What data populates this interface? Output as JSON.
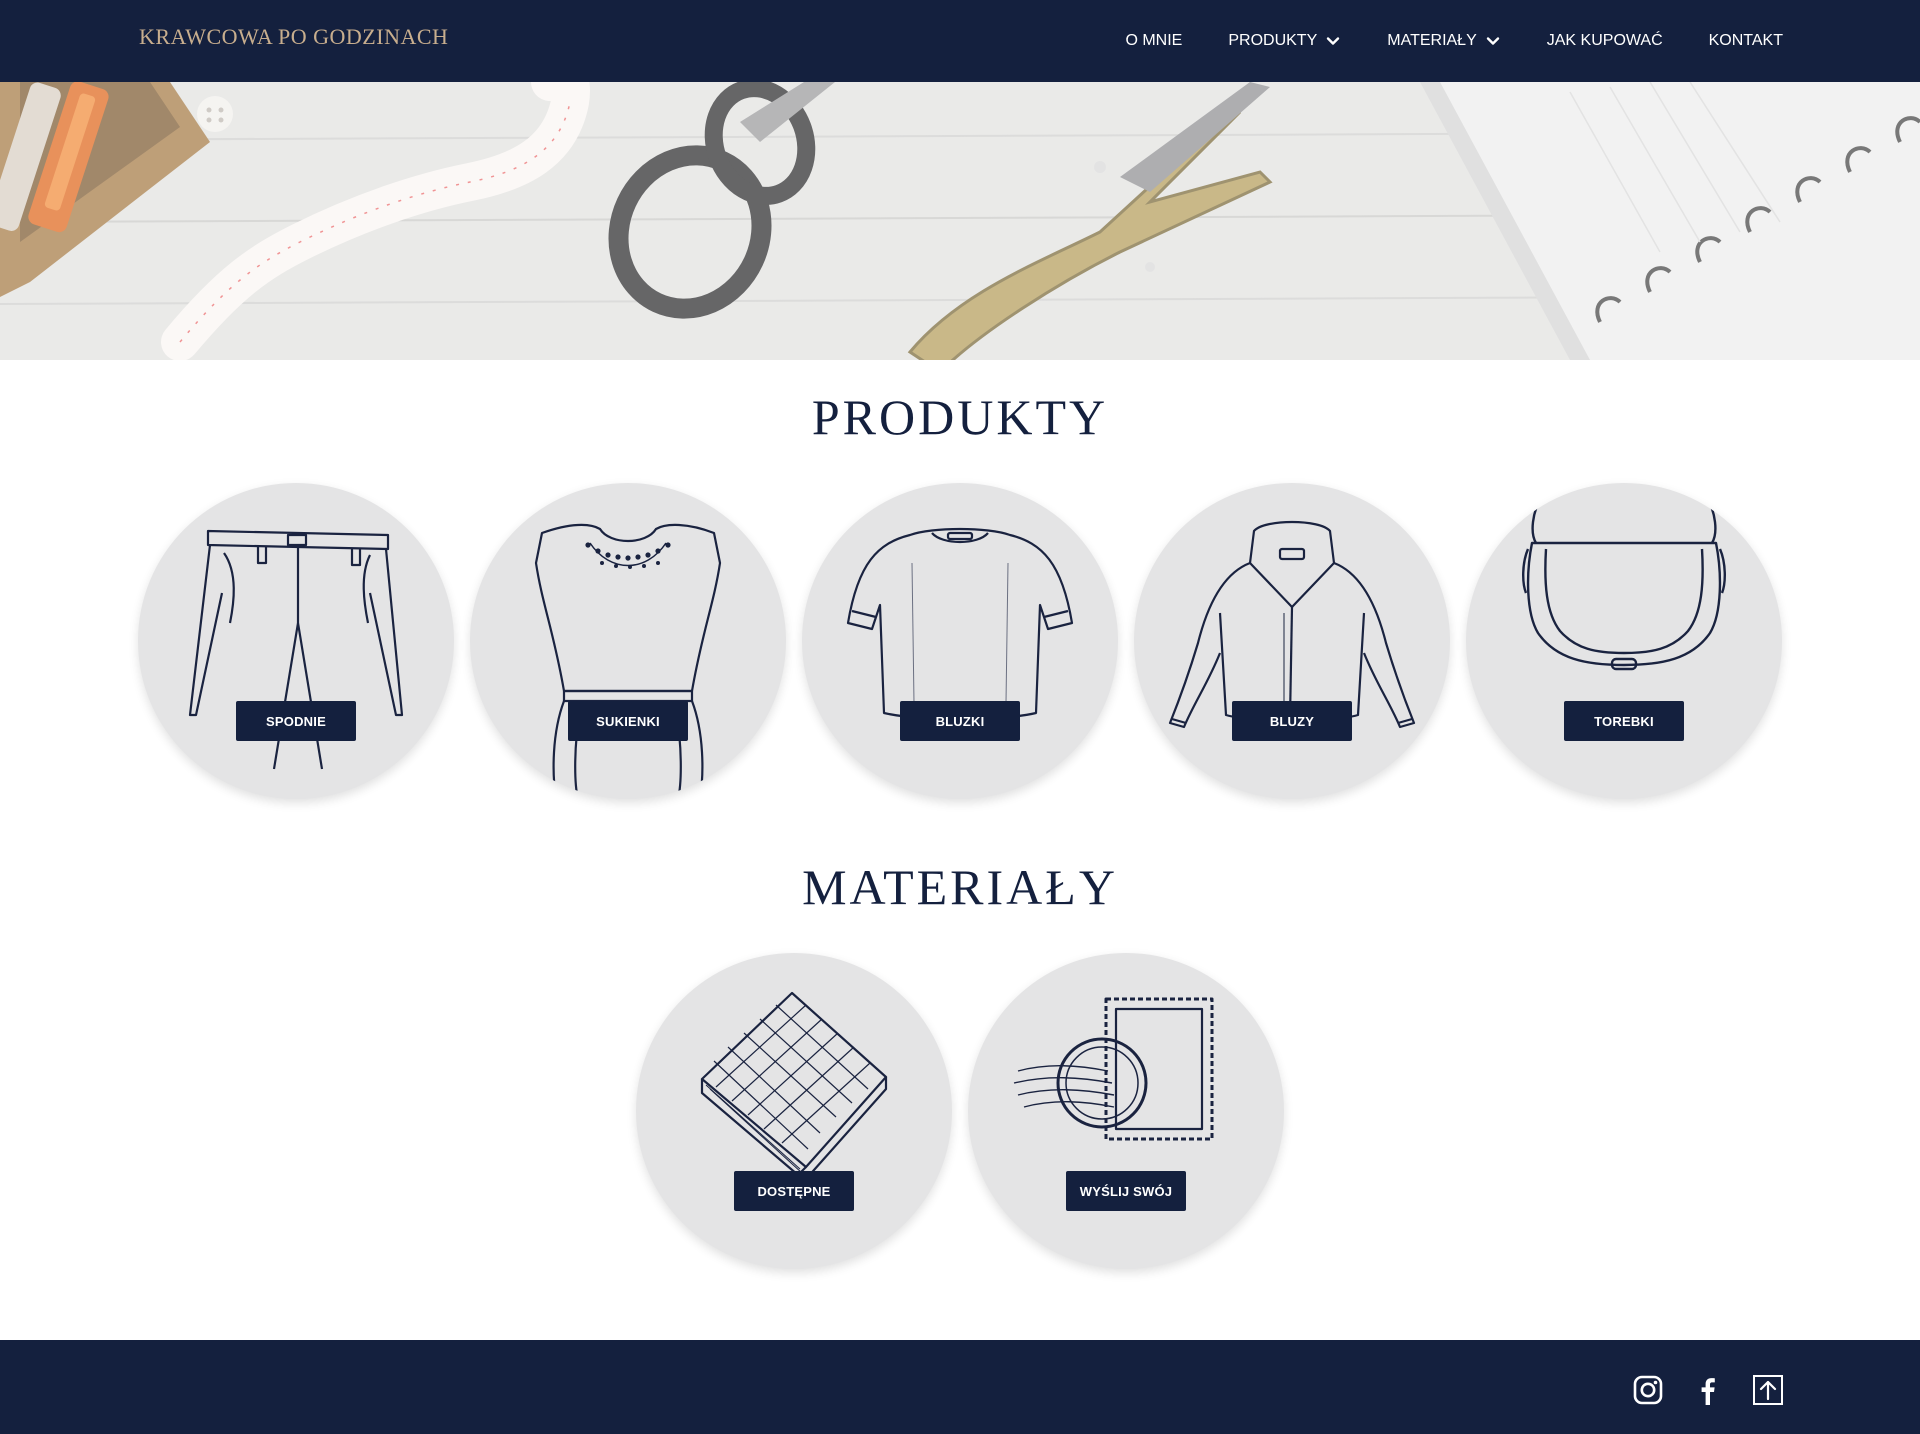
{
  "header": {
    "brand": "KRAWCOWA PO GODZINACH",
    "nav": [
      {
        "label": "O MNIE",
        "dropdown": false
      },
      {
        "label": "PRODUKTY",
        "dropdown": true
      },
      {
        "label": "MATERIAŁY",
        "dropdown": true
      },
      {
        "label": "JAK KUPOWAĆ",
        "dropdown": false
      },
      {
        "label": "KONTAKT",
        "dropdown": false
      }
    ]
  },
  "products": {
    "title": "PRODUKTY",
    "items": [
      {
        "label": "SPODNIE",
        "icon": "trousers-sketch"
      },
      {
        "label": "SUKIENKI",
        "icon": "dress-sketch"
      },
      {
        "label": "BLUZKI",
        "icon": "blouse-sketch"
      },
      {
        "label": "BLUZY",
        "icon": "jacket-sketch"
      },
      {
        "label": "TOREBKI",
        "icon": "bag-sketch"
      }
    ]
  },
  "materials": {
    "title": "MATERIAŁY",
    "items": [
      {
        "label": "DOSTĘPNE",
        "icon": "fabric-sketch"
      },
      {
        "label": "WYŚLIJ SWÓJ",
        "icon": "postage-stamp-sketch"
      }
    ]
  },
  "footer": {
    "icons": [
      "instagram-icon",
      "facebook-icon",
      "scroll-top-icon"
    ]
  },
  "colors": {
    "navy": "#14203e",
    "brand_gold": "#c8ae8e",
    "circle_bg": "#e4e4e5"
  }
}
